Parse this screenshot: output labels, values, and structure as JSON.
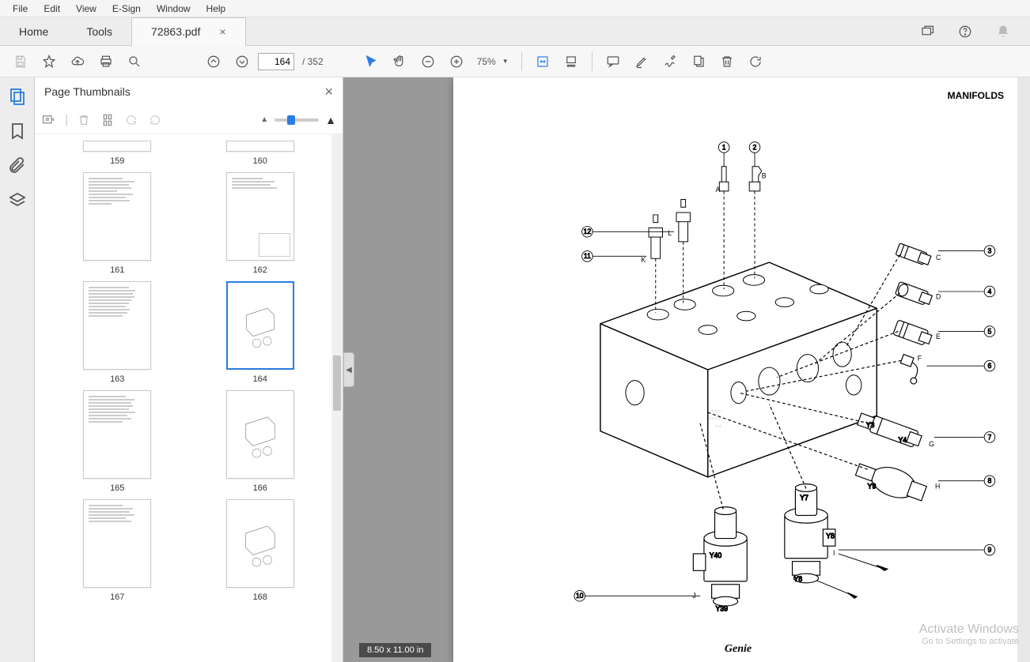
{
  "menubar": [
    "File",
    "Edit",
    "View",
    "E-Sign",
    "Window",
    "Help"
  ],
  "tabs": {
    "home": "Home",
    "tools": "Tools",
    "doc": "72863.pdf"
  },
  "toolbar": {
    "page_current": "164",
    "page_total": "/ 352",
    "zoom": "75%"
  },
  "panel": {
    "title": "Page Thumbnails"
  },
  "thumbnails": [
    {
      "n": "159"
    },
    {
      "n": "160"
    },
    {
      "n": "161"
    },
    {
      "n": "162"
    },
    {
      "n": "163"
    },
    {
      "n": "164",
      "sel": true
    },
    {
      "n": "165"
    },
    {
      "n": "166"
    },
    {
      "n": "167"
    },
    {
      "n": "168"
    }
  ],
  "page": {
    "title": "MANIFOLDS",
    "footer": "Genie",
    "dimensions": "8.50 x 11.00 in",
    "callouts": [
      "1",
      "2",
      "3",
      "4",
      "5",
      "6",
      "7",
      "8",
      "9",
      "10",
      "11",
      "12"
    ],
    "labels": [
      "A",
      "B",
      "C",
      "D",
      "E",
      "F",
      "G",
      "H",
      "I",
      "J",
      "K",
      "L"
    ],
    "wires": [
      "Y3",
      "Y4",
      "Y8",
      "Y7",
      "Y8",
      "Y39",
      "Y40"
    ]
  },
  "watermark": {
    "line1": "Activate Windows",
    "line2": "Go to Settings to activate"
  }
}
